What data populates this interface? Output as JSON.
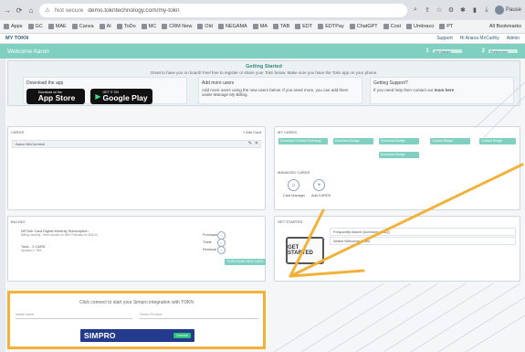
{
  "browser": {
    "url": "demo.tokntechnology.com/my-tokn",
    "security": "Not secure",
    "profile": "Pause"
  },
  "bookmarks": [
    "Apps",
    "GC",
    "MAE",
    "Canva",
    "AI",
    "ToDo",
    "MC",
    "CRM New",
    "Old",
    "NEGAMA",
    "MA",
    "TAB",
    "EDT",
    "EDTPay",
    "ChatGPT",
    "Cost",
    "Umbraco",
    "PT"
  ],
  "bookmarks_right": "All Bookmarks",
  "app": {
    "logo": "MY TOKN",
    "links": [
      "Support",
      "Hi Ariana McCarthy",
      "Admin"
    ]
  },
  "welcome": {
    "text": "Welcome Aaron",
    "step1_num": "1",
    "step1_label": "Get Started",
    "step2_num": "2",
    "step2_label": "Preferences"
  },
  "getting_started": {
    "title": "Getting Started",
    "subtitle": "Great to have you on board! Feel free to register or share your Tokn below. Make sure you have the Tokn app on your phone.",
    "col1_head": "Download the app",
    "col2_head": "Add more users",
    "col2_text": "Add more users using the new users below. If you need more, you can add them under Manage My Billing.",
    "col3_head": "Getting Support?",
    "col3_text": "If you need help then contact our",
    "col3_link": "team here",
    "appstore_small": "Download on the",
    "appstore_big": "App Store",
    "play_small": "GET IT ON",
    "play_big": "Google Play"
  },
  "cards_panel": {
    "title": "CARDS",
    "action": "+ Add Card",
    "row": "Aaron McCormick"
  },
  "services_panel": {
    "title": "MY CARDS",
    "pills": [
      "Download Contact Exchange",
      "Download Badge",
      "Download Badge",
      "Contact Badge",
      "Contact Badge",
      "Download Badge"
    ],
    "managed_title": "MANAGED CARDS",
    "manager_label": "Card Manager",
    "add_label": "Add CARDS"
  },
  "billing_panel": {
    "title": "BILLING",
    "item1": "NFCish Card Digital Monthly Subscription",
    "item1_sub": "Billing monthly - Next invoice on 28th February for $28.00",
    "item2": "Total - 1 CARD",
    "item2_sub": "Updated 1 TBA",
    "opt1": "Purchased",
    "opt2": "Trade",
    "opt3": "Renewal",
    "button": "PURCHASE NEW CARD"
  },
  "get_started_panel": {
    "title": "GET STARTED",
    "row1": "Frequently Asked Questions (FAQ)",
    "row2": "Watch Welcome Video",
    "logo_text": "GET STARTED"
  },
  "simpro": {
    "heading": "Click connect to start your Simpro integration with TOKN",
    "field1": "Install name",
    "field2": "Select Product",
    "logo": "SIMPRO",
    "connect": "Connect"
  },
  "colors": {
    "accent": "#7fd0c0",
    "brand": "#243a8c",
    "highlight": "#f2b23a"
  }
}
